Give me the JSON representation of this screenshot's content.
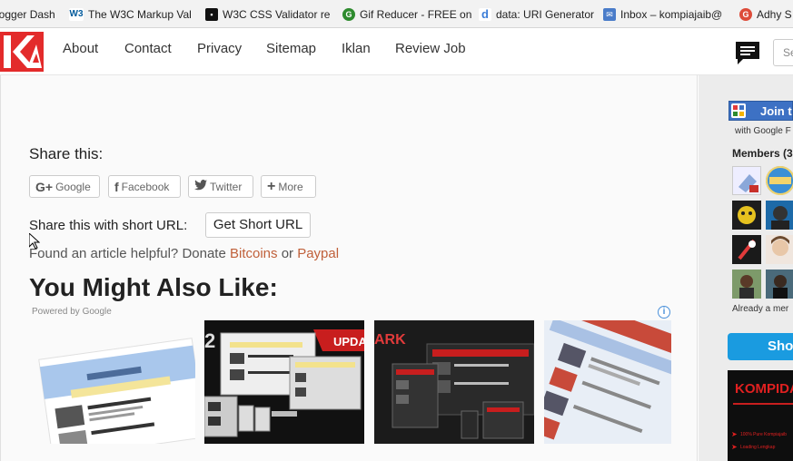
{
  "bookmarks": [
    {
      "label": "logger Dash",
      "icon": "blogger-icon",
      "color": "#f57d00"
    },
    {
      "label": "The W3C Markup Val",
      "icon": "w3c-icon",
      "color": "#005a9c"
    },
    {
      "label": "W3C CSS Validator re",
      "icon": "w3c-css-icon",
      "color": "#111111"
    },
    {
      "label": "Gif Reducer - FREE on",
      "icon": "gif-reducer-icon",
      "color": "#2e8b2e"
    },
    {
      "label": "data: URI Generator",
      "icon": "data-uri-icon",
      "color": "#3b7dd8"
    },
    {
      "label": "Inbox – kompiajaib@",
      "icon": "inbox-icon",
      "color": "#4a7cc9"
    },
    {
      "label": "Adhy S",
      "icon": "google-plus-icon",
      "color": "#dd4b39"
    }
  ],
  "nav": {
    "links": [
      "About",
      "Contact",
      "Privacy",
      "Sitemap",
      "Iklan",
      "Review Job"
    ],
    "search_placeholder": "Se"
  },
  "share": {
    "heading": "Share this:",
    "buttons": [
      {
        "label": "Google",
        "icon": "google-plus-icon"
      },
      {
        "label": "Facebook",
        "icon": "facebook-icon"
      },
      {
        "label": "Twitter",
        "icon": "twitter-icon"
      },
      {
        "label": "More",
        "icon": "plus-icon"
      }
    ],
    "short_label": "Share this with short URL:",
    "short_button": "Get Short URL"
  },
  "donate": {
    "prefix": "Found an article helpful? Donate",
    "link1": "Bitcoins",
    "middle": "or",
    "link2": "Paypal"
  },
  "related": {
    "heading": "You Might Also Like:",
    "powered_by": "Powered by Google"
  },
  "sidebar": {
    "join_button": "Join t",
    "with_google": "with Google F",
    "members_label": "Members (3",
    "already": "Already a mer",
    "show_button": "Sho",
    "banner_title": "KOMPIDAI",
    "banner_lines": [
      "100% Pure Kompiajaib",
      "Loading Lengkap"
    ]
  },
  "colors": {
    "accent_link": "#c0603a",
    "logo_red": "#e32b2b",
    "show_button_blue": "#1a9be0"
  }
}
